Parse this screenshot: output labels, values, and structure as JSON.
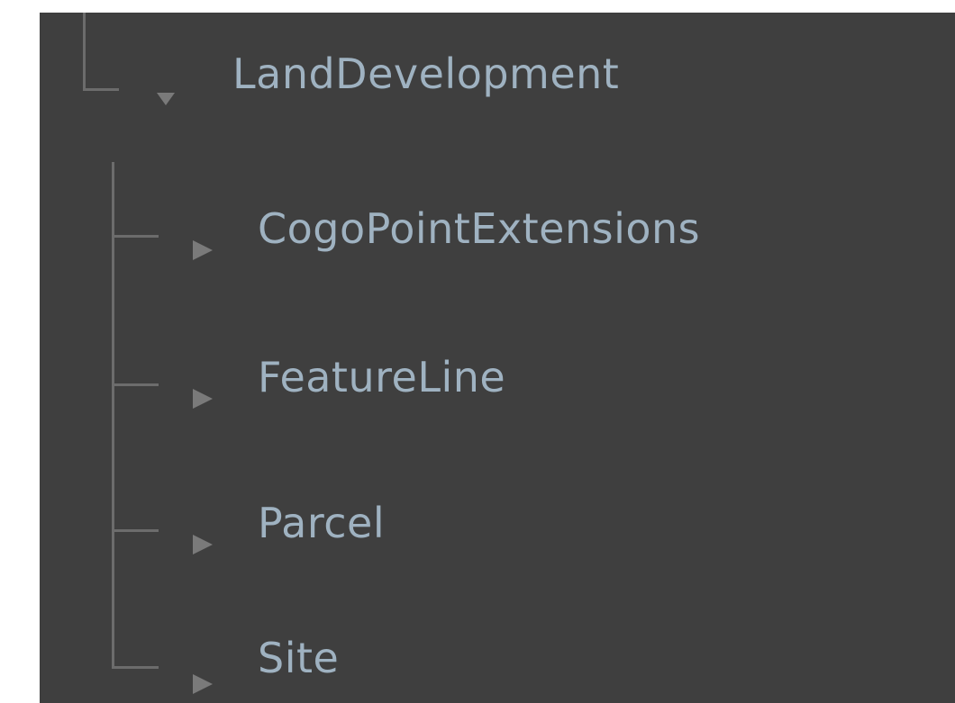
{
  "tree": {
    "parent": {
      "label": "LandDevelopment",
      "expanded": true,
      "toggle_icon": "triangle-down-icon"
    },
    "children": [
      {
        "label": "CogoPointExtensions",
        "expanded": false,
        "toggle_icon": "triangle-right-icon"
      },
      {
        "label": "FeatureLine",
        "expanded": false,
        "toggle_icon": "triangle-right-icon"
      },
      {
        "label": "Parcel",
        "expanded": false,
        "toggle_icon": "triangle-right-icon"
      },
      {
        "label": "Site",
        "expanded": false,
        "toggle_icon": "triangle-right-icon"
      }
    ]
  },
  "colors": {
    "panel_background": "#3f3f3f",
    "label_text": "#9fb2c1",
    "connector_line": "#6c6c6c",
    "toggle_arrow": "#7a7a7a",
    "outer_background": "#ffffff"
  }
}
